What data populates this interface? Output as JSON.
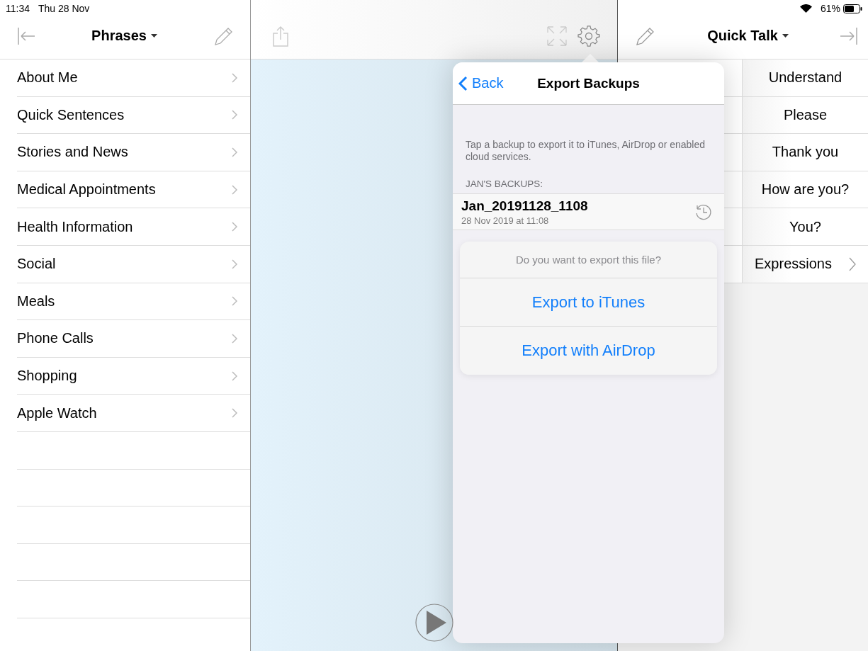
{
  "status_bar": {
    "time": "11:34",
    "date": "Thu 28 Nov",
    "battery": "61%"
  },
  "left_panel": {
    "title": "Phrases",
    "items": [
      "About Me",
      "Quick Sentences",
      "Stories and News",
      "Medical Appointments",
      "Health Information",
      "Social",
      "Meals",
      "Phone Calls",
      "Shopping",
      "Apple Watch"
    ]
  },
  "right_panel": {
    "title": "Quick Talk",
    "items": [
      {
        "label": "Understand",
        "kind": "phrase"
      },
      {
        "label": "Please",
        "kind": "phrase"
      },
      {
        "label": "Thank you",
        "kind": "phrase"
      },
      {
        "label": "How are you?",
        "kind": "phrase"
      },
      {
        "label": "You?",
        "kind": "phrase"
      },
      {
        "label": "Expressions",
        "kind": "folder"
      }
    ]
  },
  "popover": {
    "back": "Back",
    "title": "Export Backups",
    "description": "Tap a backup to export it to iTunes, AirDrop or enabled cloud services.",
    "section_header": "JAN'S BACKUPS:",
    "backup": {
      "name": "Jan_20191128_1108",
      "date": "28 Nov 2019 at 11:08"
    },
    "action_sheet": {
      "message": "Do you want to export this file?",
      "actions": [
        "Export to iTunes",
        "Export with AirDrop"
      ]
    }
  }
}
